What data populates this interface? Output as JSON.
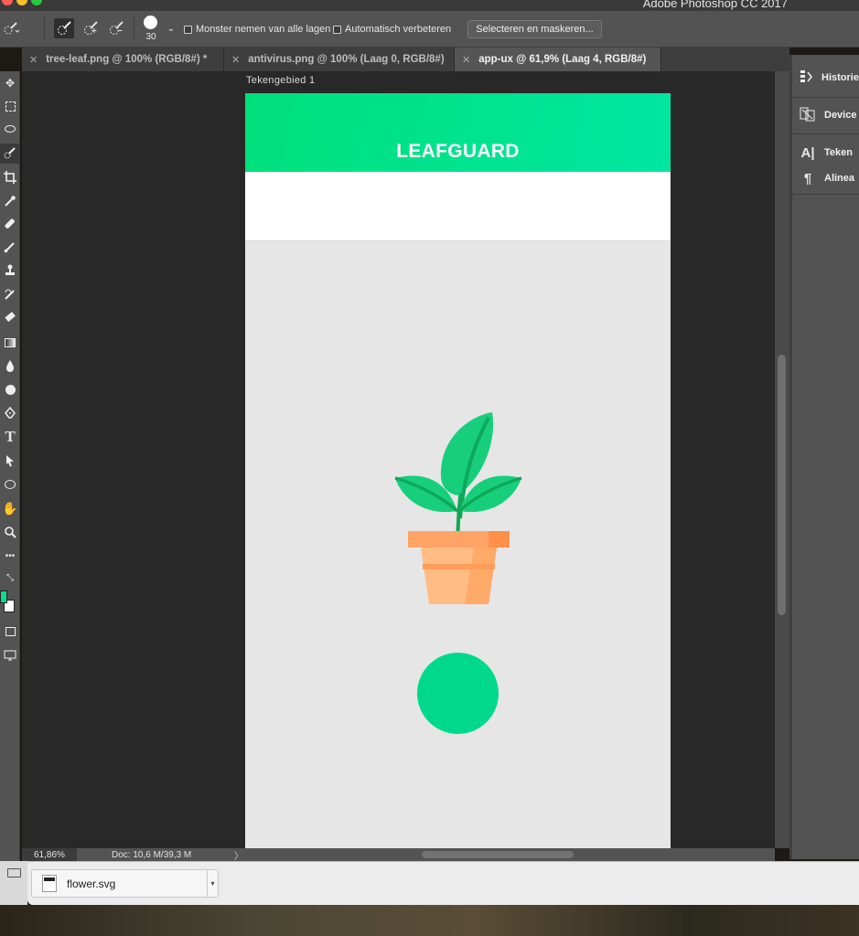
{
  "window": {
    "app_title": "Adobe Photoshop CC 2017"
  },
  "options_bar": {
    "brush_size": "30",
    "sample_all_layers_label": "Monster nemen van alle lagen",
    "auto_enhance_label": "Automatisch verbeteren",
    "select_and_mask_label": "Selecteren en maskeren..."
  },
  "tabs": [
    {
      "label": "tree-leaf.png @ 100% (RGB/8#) *"
    },
    {
      "label": "antivirus.png @ 100% (Laag 0, RGB/8#)"
    },
    {
      "label": "app-ux @ 61,9% (Laag 4, RGB/8#)"
    }
  ],
  "canvas": {
    "artboard_label": "Tekengebied 1",
    "app_name": "LEAFGUARD"
  },
  "status": {
    "zoom": "61,86%",
    "doc_size": "Doc: 10,6 M/39,3 M",
    "arrow": "〉"
  },
  "panels": [
    {
      "label": "Historie",
      "icon": "history-icon"
    },
    {
      "label": "Device",
      "icon": "device-preview-icon"
    },
    {
      "label": "Teken",
      "icon": "character-icon"
    },
    {
      "label": "Alinea",
      "icon": "paragraph-icon"
    }
  ],
  "download": {
    "filename": "flower.svg"
  },
  "colors": {
    "foreground": "#10d98c",
    "background": "#ffffff",
    "header_gradient_start": "#00e07a",
    "header_gradient_end": "#00e6a2",
    "circle": "#00d98d"
  }
}
